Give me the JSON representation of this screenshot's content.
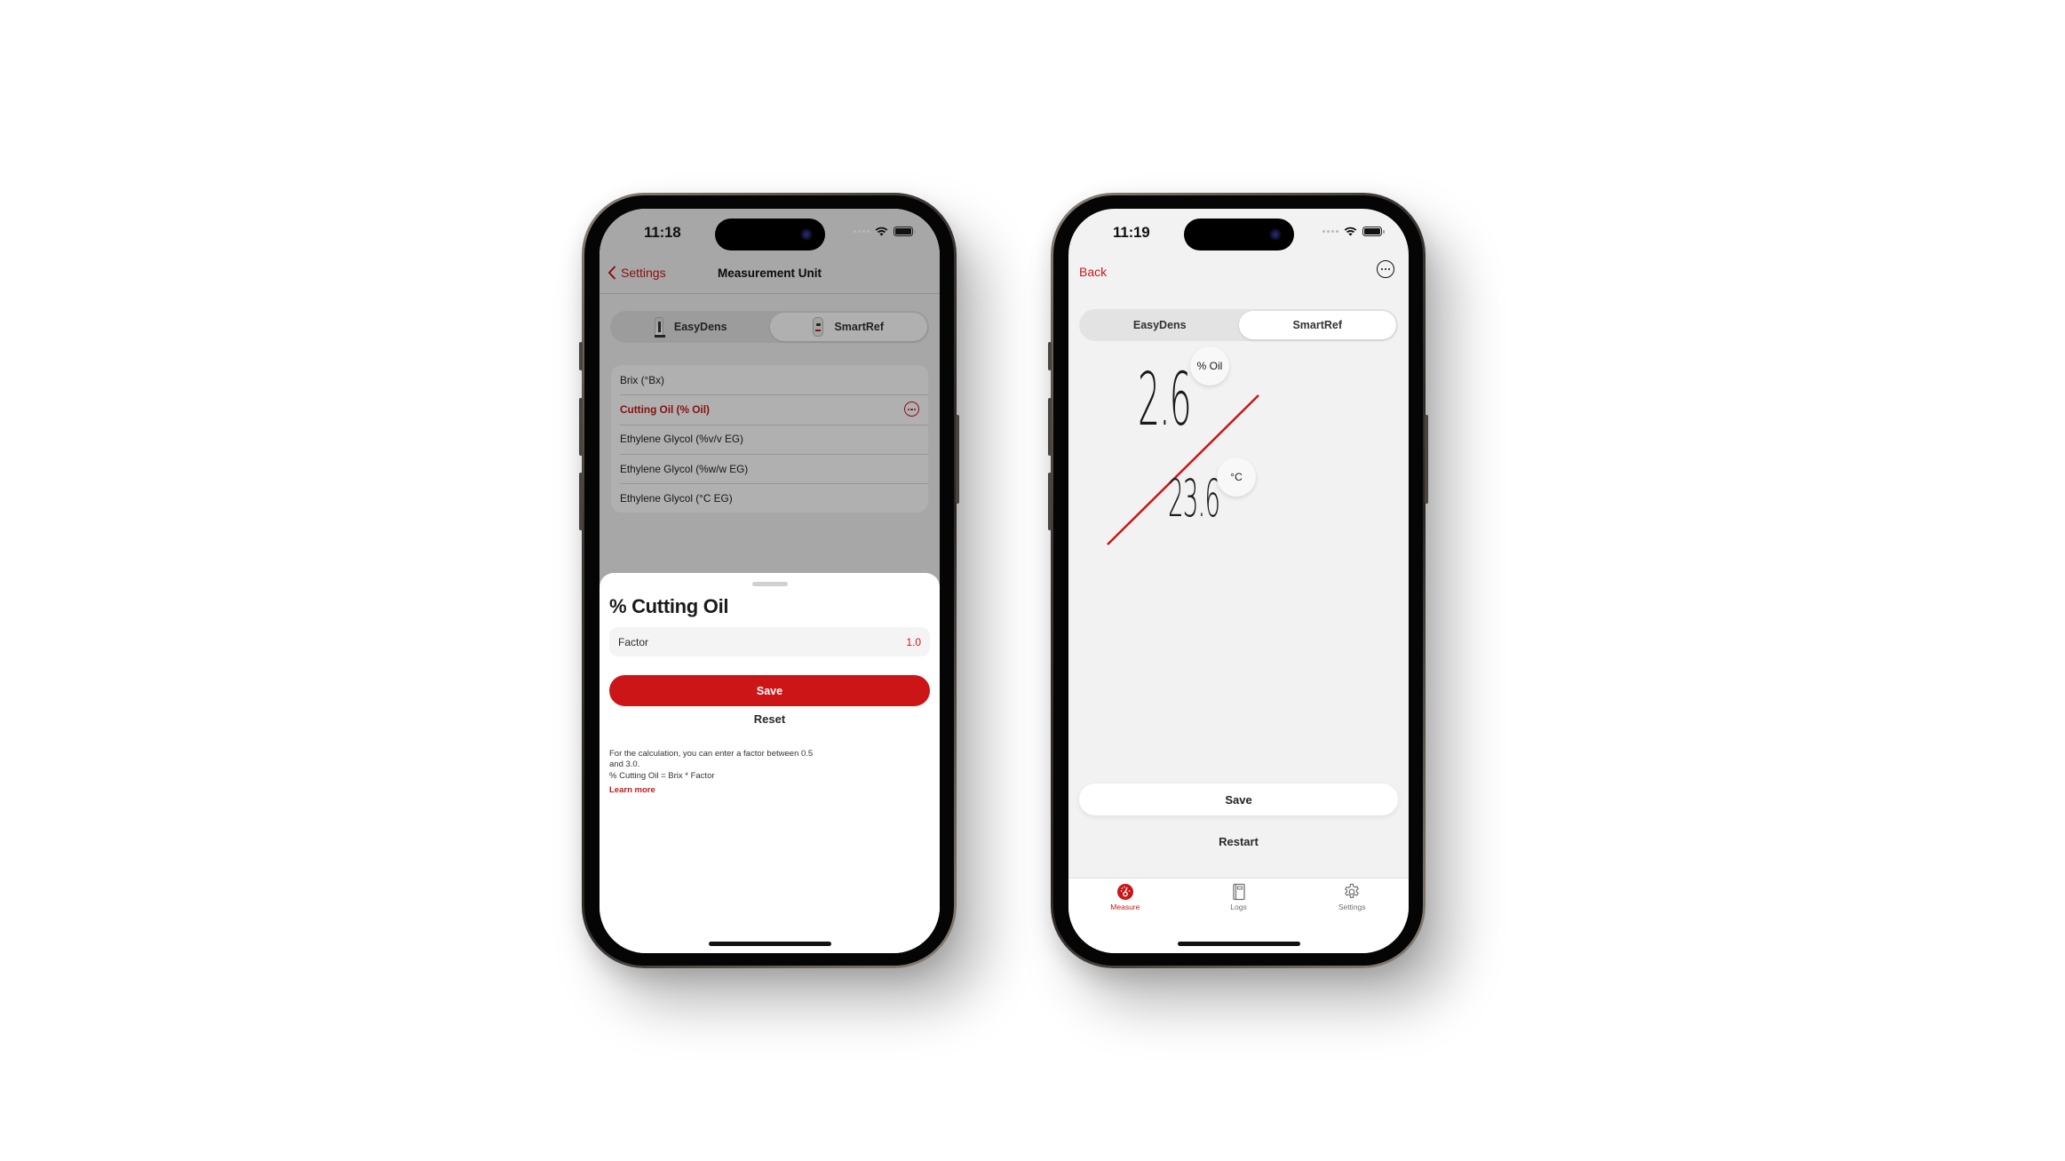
{
  "phones": [
    {
      "id": "measurement-unit",
      "status_bar": {
        "time": "11:18"
      },
      "nav": {
        "back_label": "Settings",
        "title": "Measurement Unit"
      },
      "segmented": [
        {
          "label": "EasyDens",
          "icon": "easydens-device-icon",
          "active": false
        },
        {
          "label": "SmartRef",
          "icon": "smartref-device-icon",
          "active": true
        }
      ],
      "units": [
        {
          "label": "Brix (°Bx)",
          "selected": false
        },
        {
          "label": "Cutting Oil (% Oil)",
          "selected": true,
          "has_more": true
        },
        {
          "label": "Ethylene Glycol (%v/v EG)",
          "selected": false
        },
        {
          "label": "Ethylene Glycol (%w/w EG)",
          "selected": false
        },
        {
          "label": "Ethylene Glycol (°C EG)",
          "selected": false
        }
      ],
      "sheet": {
        "title": "% Cutting Oil",
        "factor_label": "Factor",
        "factor_value": "1.0",
        "save_label": "Save",
        "reset_label": "Reset",
        "help_text": "For the calculation, you can enter a factor between 0.5\nand 3.0.\n% Cutting Oil = Brix * Factor",
        "learn_more": "Learn more"
      }
    },
    {
      "id": "measure",
      "status_bar": {
        "time": "11:19"
      },
      "nav": {
        "back_label": "Back",
        "more_icon": "more-circle-icon"
      },
      "segmented": [
        {
          "label": "EasyDens",
          "active": false
        },
        {
          "label": "SmartRef",
          "active": true
        }
      ],
      "reading": {
        "value": "2.6",
        "unit": "% Oil",
        "temperature": "23.6",
        "temperature_unit": "°C"
      },
      "save_label": "Save",
      "restart_label": "Restart",
      "tabs": [
        {
          "label": "Measure",
          "icon": "gauge-icon",
          "active": true
        },
        {
          "label": "Logs",
          "icon": "notebook-icon",
          "active": false
        },
        {
          "label": "Settings",
          "icon": "gear-icon",
          "active": false
        }
      ]
    }
  ],
  "colors": {
    "accent": "#c8181a",
    "primary_button": "#cb1517",
    "screen_bg": "#f2f2f2",
    "dim_overlay": "rgba(0,0,0,0.31)"
  }
}
